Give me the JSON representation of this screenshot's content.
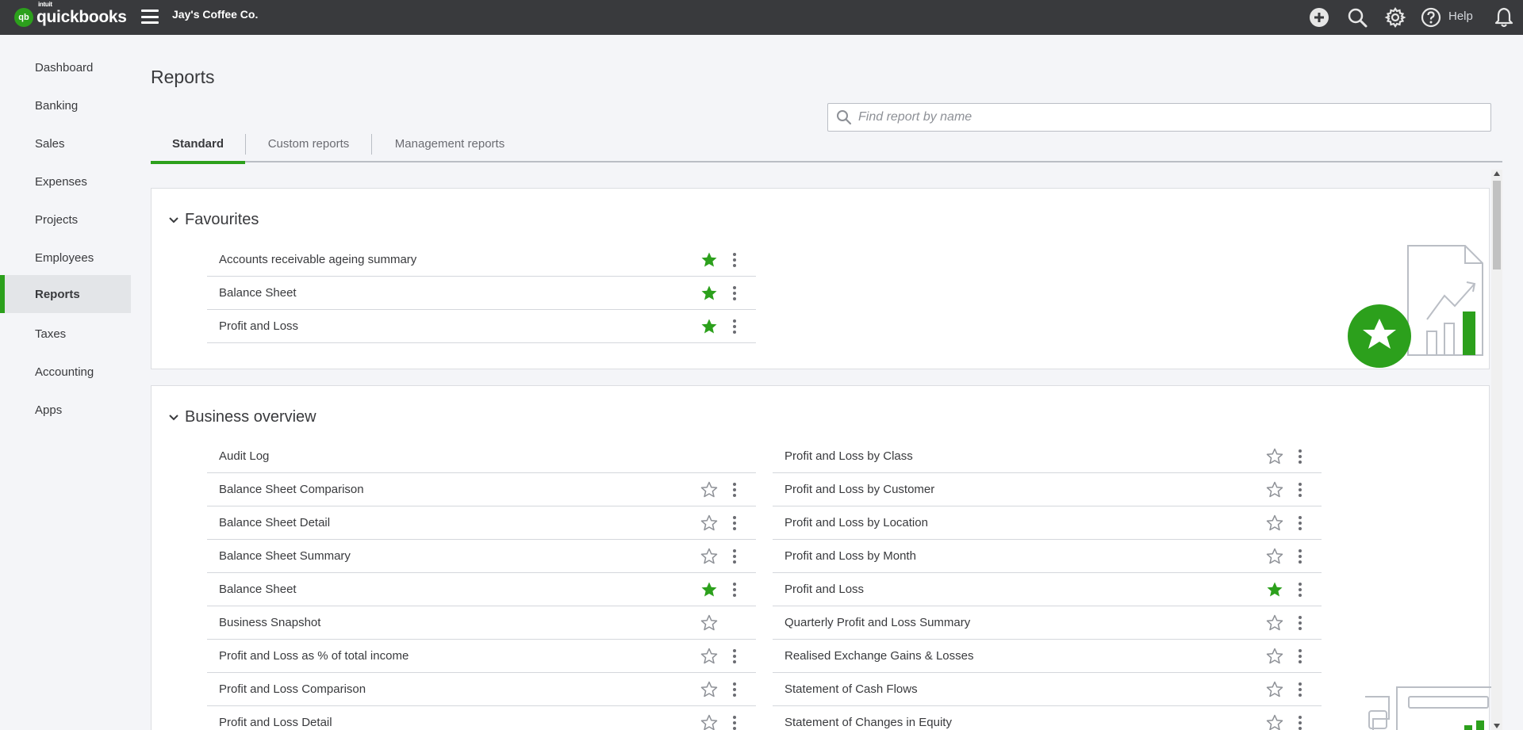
{
  "app": {
    "logo_brand": "intuit",
    "logo_text": "quickbooks",
    "logo_mark": "qb",
    "company_name": "Jay's Coffee Co."
  },
  "topbar": {
    "help_label": "Help",
    "icons": [
      "plus-icon",
      "search-icon",
      "gear-icon",
      "help-icon",
      "bell-icon"
    ]
  },
  "sidebar": {
    "items": [
      {
        "label": "Dashboard"
      },
      {
        "label": "Banking"
      },
      {
        "label": "Sales"
      },
      {
        "label": "Expenses"
      },
      {
        "label": "Projects"
      },
      {
        "label": "Employees"
      },
      {
        "label": "Reports",
        "active": true
      },
      {
        "label": "Taxes"
      },
      {
        "label": "Accounting"
      },
      {
        "label": "Apps"
      }
    ]
  },
  "main": {
    "title": "Reports",
    "search": {
      "placeholder": "Find report by name",
      "value": ""
    },
    "tabs": [
      {
        "label": "Standard",
        "active": true
      },
      {
        "label": "Custom reports"
      },
      {
        "label": "Management reports"
      }
    ]
  },
  "favourites": {
    "title": "Favourites",
    "rows": [
      {
        "label": "Accounts receivable ageing summary",
        "starred": true
      },
      {
        "label": "Balance Sheet",
        "starred": true
      },
      {
        "label": "Profit and Loss",
        "starred": true
      }
    ]
  },
  "business_overview": {
    "title": "Business overview",
    "left": [
      {
        "label": "Audit Log",
        "starred": null
      },
      {
        "label": "Balance Sheet Comparison",
        "starred": false
      },
      {
        "label": "Balance Sheet Detail",
        "starred": false
      },
      {
        "label": "Balance Sheet Summary",
        "starred": false
      },
      {
        "label": "Balance Sheet",
        "starred": true
      },
      {
        "label": "Business Snapshot",
        "starred": false,
        "no_menu": true
      },
      {
        "label": "Profit and Loss as % of total income",
        "starred": false
      },
      {
        "label": "Profit and Loss Comparison",
        "starred": false
      },
      {
        "label": "Profit and Loss Detail",
        "starred": false
      }
    ],
    "right": [
      {
        "label": "Profit and Loss by Class",
        "starred": false
      },
      {
        "label": "Profit and Loss by Customer",
        "starred": false
      },
      {
        "label": "Profit and Loss by Location",
        "starred": false
      },
      {
        "label": "Profit and Loss by Month",
        "starred": false
      },
      {
        "label": "Profit and Loss",
        "starred": true
      },
      {
        "label": "Quarterly Profit and Loss Summary",
        "starred": false
      },
      {
        "label": "Realised Exchange Gains & Losses",
        "starred": false
      },
      {
        "label": "Statement of Cash Flows",
        "starred": false
      },
      {
        "label": "Statement of Changes in Equity",
        "starred": false
      }
    ]
  },
  "colors": {
    "topbar": "#393a3d",
    "accent_green": "#2ca01c",
    "star_outline": "#8d9096"
  }
}
